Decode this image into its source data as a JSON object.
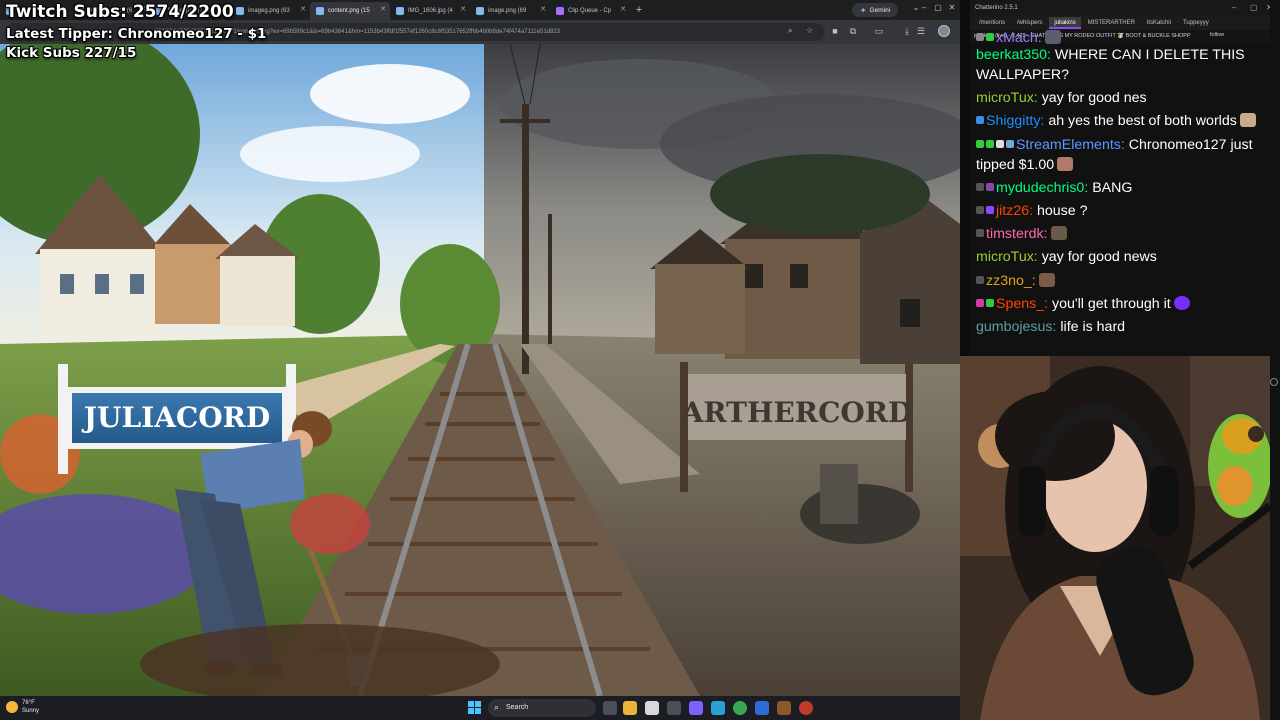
{
  "browser": {
    "tabs": [
      {
        "label": "",
        "active": false
      },
      {
        "label": "IMG_1611.jpg (6",
        "active": false
      },
      {
        "label": "fighter.png (120",
        "active": false
      },
      {
        "label": "imageg.png (63",
        "active": false
      },
      {
        "label": "content.png (15",
        "active": true
      },
      {
        "label": "IMG_1606.jpg (4",
        "active": false
      },
      {
        "label": "image.png (69",
        "active": false
      },
      {
        "label": "Clip Queue - Cp",
        "active": false
      }
    ],
    "gemini_label": "Gemini",
    "url": "20129/1482049607151390771/content.png?ex=69b589c1&is=69b43841&hm=1153b43ffdf1f557ef1260c8c8f53517652ff6b4b0b8de74f474a7111e51d823"
  },
  "scene": {
    "left_sign": "JULIACORD",
    "right_sign": "ARTHERCORD"
  },
  "overlay": {
    "twitch_subs": "Twitch Subs: 2574/2200",
    "latest_tipper": "Latest Tipper: Chronomeo127 - $1",
    "kick_subs": "Kick Subs 227/15"
  },
  "taskbar": {
    "temperature": "76°F",
    "weather": "Sunny",
    "search_label": "Search"
  },
  "chat": {
    "app_title": "Chatterino 2.5.1",
    "tabs": [
      "/mentions",
      "/whispers",
      "juliakins",
      "MISTERARTHER",
      "itsKatchii",
      "Tuppeyyy"
    ],
    "active_tab": 2,
    "header": "juliakins (live) - 2,429 - CHAT PICKS MY RODEO OUTFIT 🐮 BOOT & BUCKLE SHOPP",
    "follow_label": "follow",
    "messages": [
      {
        "user": "xMach:",
        "text": "",
        "color": "#9b7bff"
      },
      {
        "user": "beerkat350:",
        "text": "WHERE CAN I DELETE THIS WALLPAPER?",
        "color": "#00ff7f"
      },
      {
        "user": "microTux:",
        "text": "yay for good nes",
        "color": "#9acd32"
      },
      {
        "user": "Shiggitty:",
        "text": "ah yes the best of both worlds",
        "color": "#1e90ff"
      },
      {
        "user": "StreamElements:",
        "text": "Chronomeo127 just tipped $1.00",
        "color": "#5b99ff"
      },
      {
        "user": "mydudechris0:",
        "text": "BANG",
        "color": "#00ff7f"
      },
      {
        "user": "jitz26:",
        "text": "house ?",
        "color": "#ff4500"
      },
      {
        "user": "timsterdk:",
        "text": "",
        "color": "#ff69b4"
      },
      {
        "user": "microTux:",
        "text": "yay for good news",
        "color": "#9acd32"
      },
      {
        "user": "zz3no_:",
        "text": "",
        "color": "#daa520"
      },
      {
        "user": "Spens_:",
        "text": "you'll get through it",
        "color": "#ff4500"
      },
      {
        "user": "gumbojesus:",
        "text": "life is hard",
        "color": "#5f9ea0"
      }
    ]
  }
}
